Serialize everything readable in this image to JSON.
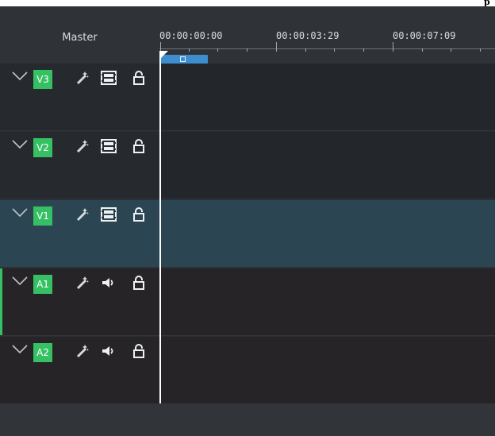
{
  "window": {
    "top_glyph": "p"
  },
  "header": {
    "master_label": "Master"
  },
  "ruler": {
    "timecodes": [
      "00:00:00:00",
      "00:00:03:29",
      "00:00:07:09"
    ]
  },
  "tracks": [
    {
      "id": "V3",
      "type": "video",
      "selected": false,
      "icons": [
        "expand-icon",
        "effect-wand-icon",
        "film-strip-icon",
        "lock-icon"
      ]
    },
    {
      "id": "V2",
      "type": "video",
      "selected": false,
      "icons": [
        "expand-icon",
        "effect-wand-icon",
        "film-strip-icon",
        "lock-icon"
      ]
    },
    {
      "id": "V1",
      "type": "video",
      "selected": true,
      "icons": [
        "expand-icon",
        "effect-wand-icon",
        "film-strip-icon",
        "lock-icon"
      ]
    },
    {
      "id": "A1",
      "type": "audio",
      "selected": false,
      "icons": [
        "expand-icon",
        "effect-wand-icon",
        "speaker-icon",
        "lock-icon"
      ]
    },
    {
      "id": "A2",
      "type": "audio",
      "selected": false,
      "icons": [
        "expand-icon",
        "effect-wand-icon",
        "speaker-icon",
        "lock-icon"
      ]
    }
  ],
  "colors": {
    "track_tag": "#35c163",
    "selected_track": "#2b4552",
    "zone": "#3d8ecf",
    "playhead": "#ffffff"
  }
}
